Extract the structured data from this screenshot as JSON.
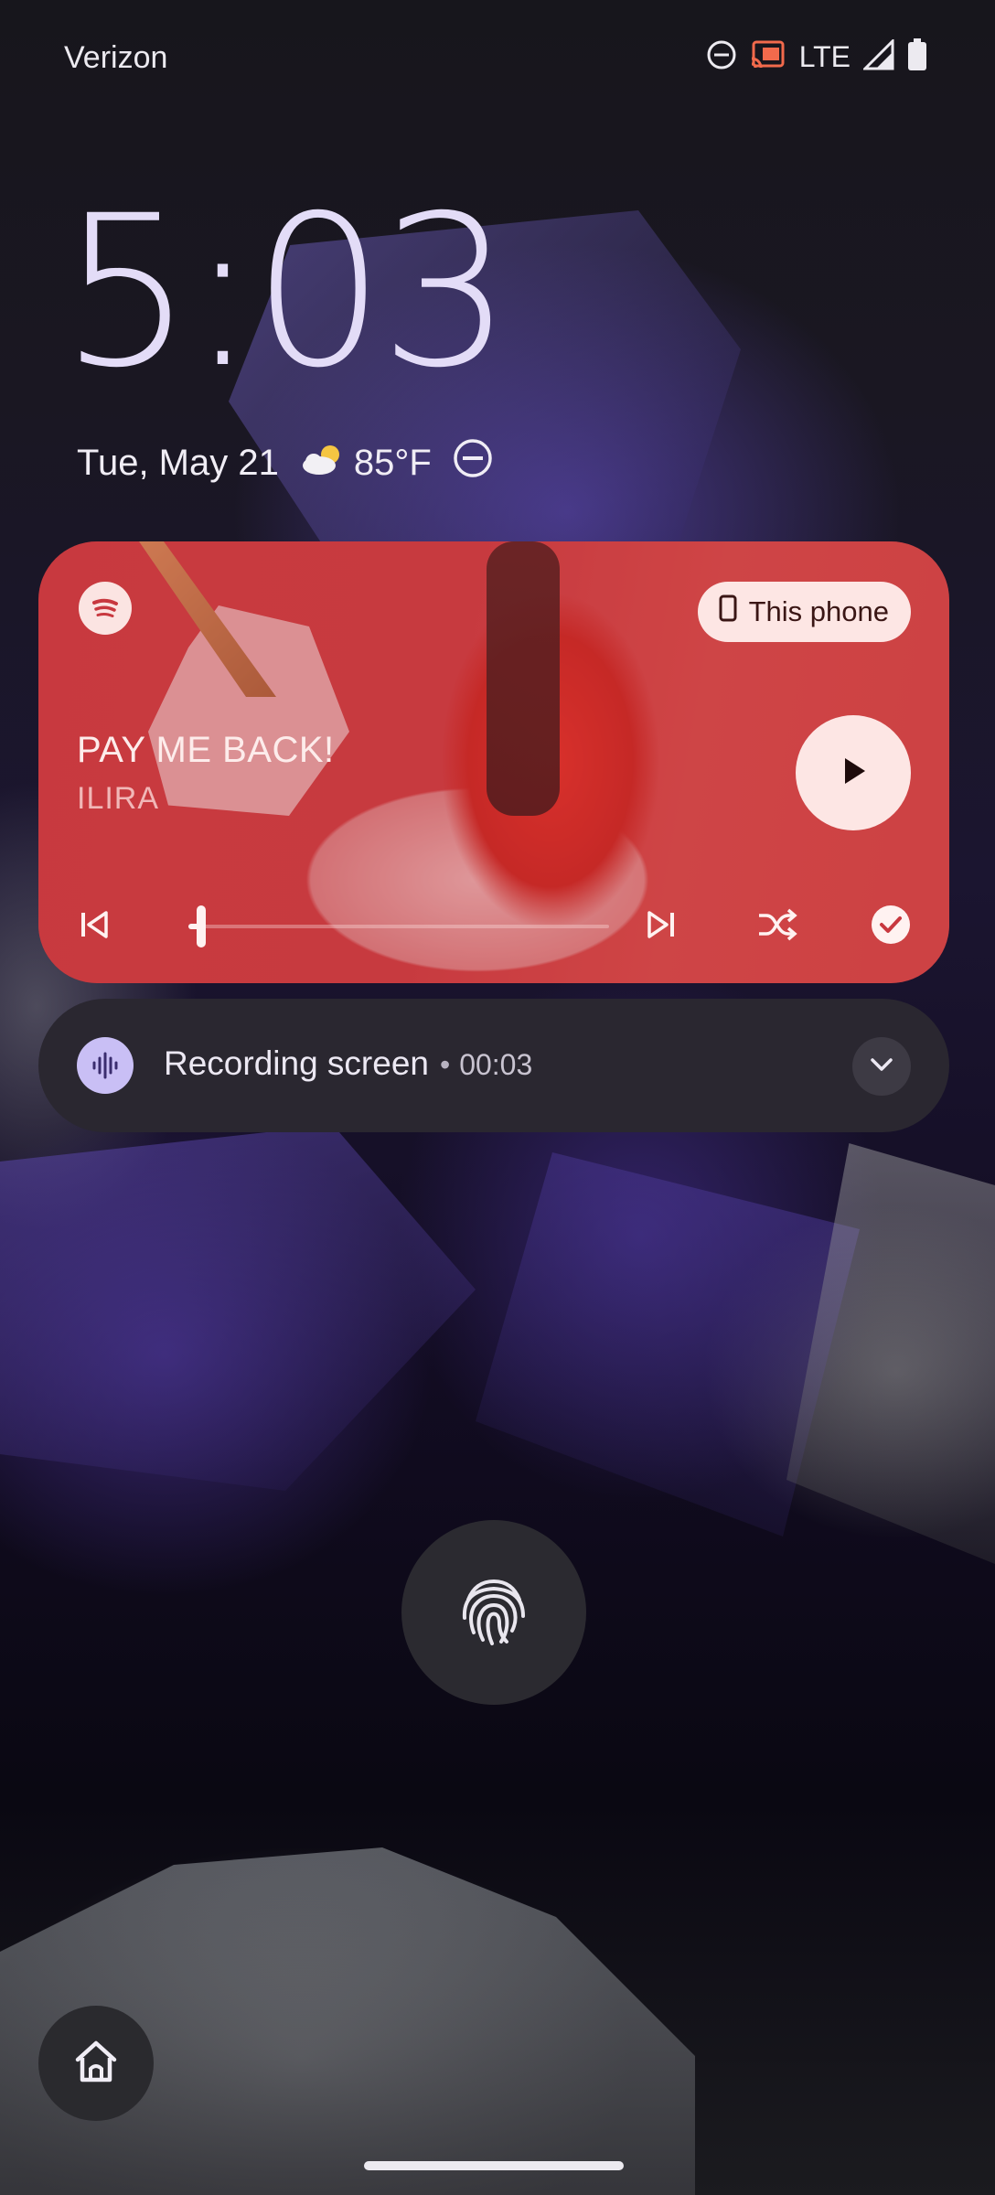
{
  "status_bar": {
    "carrier": "Verizon",
    "network": "LTE",
    "icons": [
      "do-not-disturb-icon",
      "cast-icon",
      "signal-icon",
      "battery-icon"
    ]
  },
  "lockscreen": {
    "time": "5:03",
    "date": "Tue, May 21",
    "temperature": "85°F",
    "weather_icon": "partly-cloudy-icon",
    "dnd_icon": "do-not-disturb-icon"
  },
  "media": {
    "app_icon": "spotify-icon",
    "output_device": "This phone",
    "title": "PAY ME BACK!",
    "artist": "ILIRA",
    "progress": 0.03,
    "accent": "#c8383f"
  },
  "notification": {
    "title": "Recording screen",
    "separator": "•",
    "elapsed": "00:03",
    "icon": "screen-record-icon",
    "accent": "#c9bff5"
  },
  "colors": {
    "clock": "#e3dcf7",
    "card_background": "#2a2730"
  }
}
